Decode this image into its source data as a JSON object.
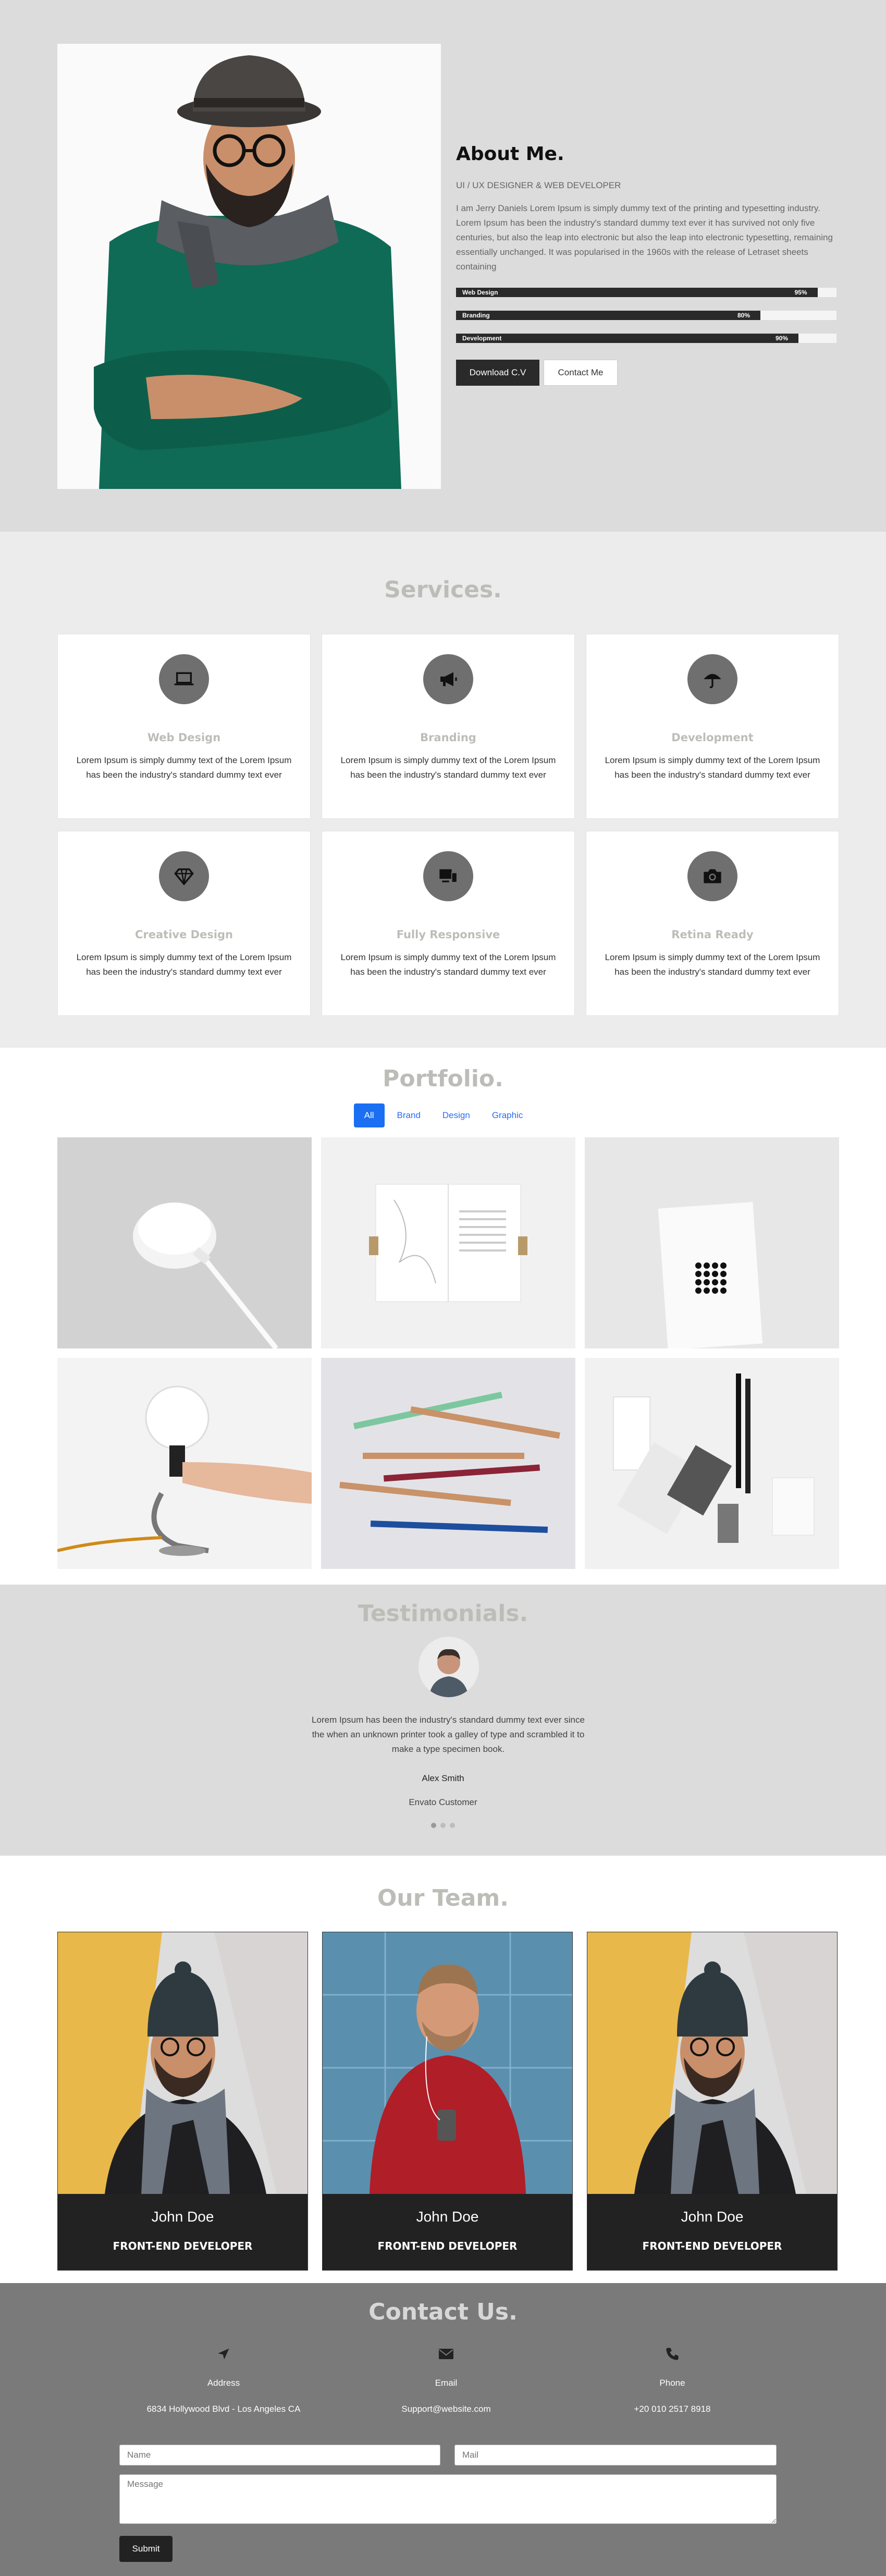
{
  "about": {
    "title": "About Me.",
    "subtitle": "UI / UX DESIGNER & WEB DEVELOPER",
    "description": "I am Jerry Daniels Lorem Ipsum is simply dummy text of the printing and typesetting industry. Lorem Ipsum has been the industry's standard dummy text ever it has survived not only five centuries, but also the leap into electronic but also the leap into electronic typesetting, remaining essentially unchanged. It was popularised in the 1960s with the release of Letraset sheets containing",
    "skills": [
      {
        "label": "Web Design",
        "percent_text": "95%",
        "value": 95
      },
      {
        "label": "Branding",
        "percent_text": "80%",
        "value": 80
      },
      {
        "label": "Development",
        "percent_text": "90%",
        "value": 90
      }
    ],
    "download_label": "Download C.V",
    "contact_label": "Contact Me"
  },
  "services": {
    "title": "Services.",
    "items": [
      {
        "icon": "laptop-icon",
        "title": "Web Design",
        "text": "Lorem Ipsum is simply dummy text of the Lorem Ipsum has been the industry's standard dummy text ever"
      },
      {
        "icon": "megaphone-icon",
        "title": "Branding",
        "text": "Lorem Ipsum is simply dummy text of the Lorem Ipsum has been the industry's standard dummy text ever"
      },
      {
        "icon": "umbrella-icon",
        "title": "Development",
        "text": "Lorem Ipsum is simply dummy text of the Lorem Ipsum has been the industry's standard dummy text ever"
      },
      {
        "icon": "diamond-icon",
        "title": "Creative Design",
        "text": "Lorem Ipsum is simply dummy text of the Lorem Ipsum has been the industry's standard dummy text ever"
      },
      {
        "icon": "devices-icon",
        "title": "Fully Responsive",
        "text": "Lorem Ipsum is simply dummy text of the Lorem Ipsum has been the industry's standard dummy text ever"
      },
      {
        "icon": "camera-icon",
        "title": "Retina Ready",
        "text": "Lorem Ipsum is simply dummy text of the Lorem Ipsum has been the industry's standard dummy text ever"
      }
    ]
  },
  "portfolio": {
    "title": "Portfolio.",
    "filters": [
      "All",
      "Brand",
      "Design",
      "Graphic"
    ],
    "active_filter": "All"
  },
  "testimonials": {
    "title": "Testimonials.",
    "quote": "Lorem Ipsum has been the industry's standard dummy text ever since the when an unknown printer took a galley of type and scrambled it to make a type specimen book.",
    "name": "Alex Smith",
    "role": "Envato Customer"
  },
  "team": {
    "title": "Our Team.",
    "members": [
      {
        "name": "John Doe",
        "role": "FRONT-END DEVELOPER"
      },
      {
        "name": "John Doe",
        "role": "FRONT-END DEVELOPER"
      },
      {
        "name": "John Doe",
        "role": "FRONT-END DEVELOPER"
      }
    ]
  },
  "contact": {
    "title": "Contact Us.",
    "address_label": "Address",
    "address_value": "6834 Hollywood Blvd - Los Angeles CA",
    "email_label": "Email",
    "email_value": "Support@website.com",
    "phone_label": "Phone",
    "phone_value": "+20 010 2517 8918",
    "name_placeholder": "Name",
    "mail_placeholder": "Mail",
    "message_placeholder": "Message",
    "submit_label": "Submit"
  },
  "colors": {
    "accent_blue": "#1a6ff2",
    "dark": "#2a2a2a",
    "section_title_gray": "#bdbdb8"
  }
}
